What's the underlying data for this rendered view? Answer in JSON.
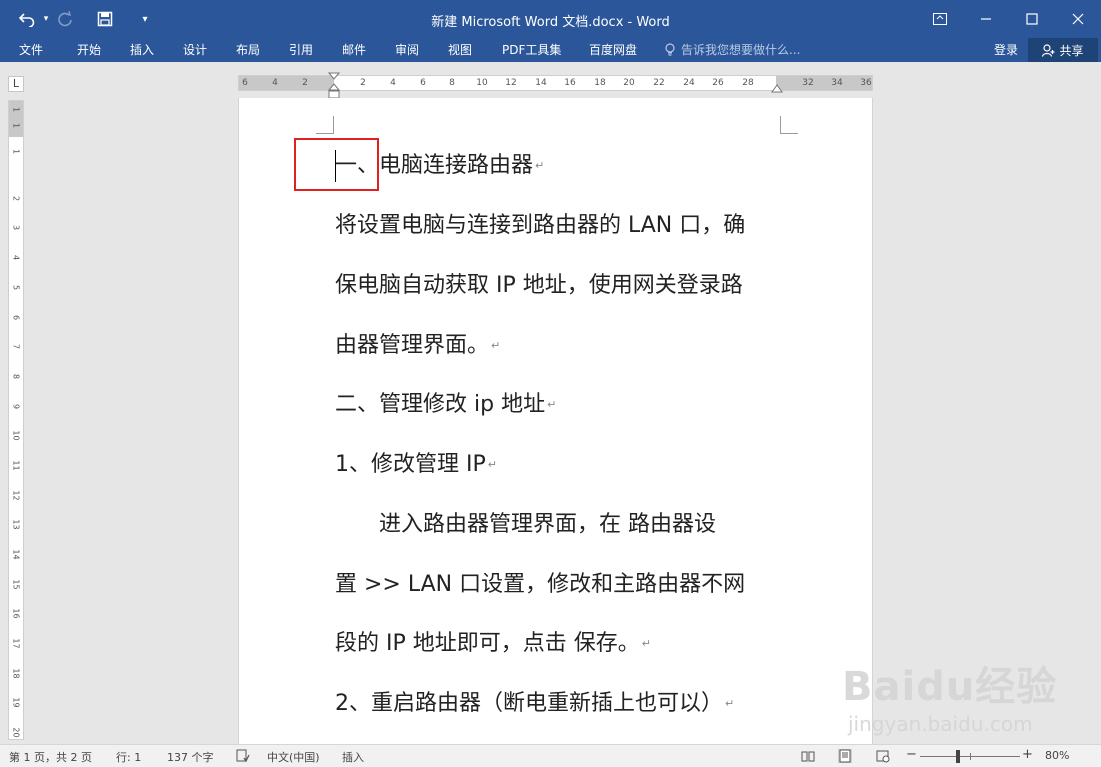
{
  "window": {
    "title": "新建 Microsoft Word 文档.docx - Word"
  },
  "quick_access": {
    "undo_icon": "undo-icon",
    "redo_icon": "redo-icon",
    "save_icon": "save-icon",
    "customize_icon": "customize-qat-icon"
  },
  "tabs": [
    "文件",
    "开始",
    "插入",
    "设计",
    "布局",
    "引用",
    "邮件",
    "审阅",
    "视图",
    "PDF工具集",
    "百度网盘"
  ],
  "tell_me": "告诉我您想要做什么...",
  "account": {
    "login": "登录",
    "share": "共享"
  },
  "ruler": {
    "corner": "L",
    "h_ticks": [
      "6",
      "4",
      "2",
      "2",
      "4",
      "6",
      "8",
      "10",
      "12",
      "14",
      "16",
      "18",
      "20",
      "22",
      "24",
      "26",
      "28",
      "32",
      "34",
      "36"
    ],
    "v_ticks": [
      "1",
      "1",
      "1",
      "2",
      "3",
      "4",
      "5",
      "6",
      "7",
      "8",
      "9",
      "10",
      "11",
      "12",
      "13",
      "14",
      "15",
      "16",
      "17",
      "18",
      "19",
      "20"
    ]
  },
  "document": {
    "lines": [
      {
        "text": "一、电脑连接路由器",
        "mark": "↵"
      },
      {
        "text": "将设置电脑与连接到路由器的 LAN 口，确",
        "mark": ""
      },
      {
        "text": "保电脑自动获取 IP 地址，使用网关登录路",
        "mark": ""
      },
      {
        "text": "由器管理界面。",
        "mark": "↵"
      },
      {
        "text": "二、管理修改 ip 地址",
        "mark": "↵"
      },
      {
        "text": "1、修改管理 IP",
        "mark": "↵"
      },
      {
        "text": "　　进入路由器管理界面，在  路由器设",
        "mark": ""
      },
      {
        "text": "置  >> LAN 口设置，修改和主路由器不网",
        "mark": ""
      },
      {
        "text": "段的 IP 地址即可，点击  保存。",
        "mark": "↵"
      },
      {
        "text": "2、重启路由器（断电重新插上也可以）",
        "mark": "↵"
      }
    ]
  },
  "watermark": {
    "logo": "Baidu经验",
    "url": "jingyan.baidu.com"
  },
  "status": {
    "page": "第 1 页，共 2 页",
    "line": "行: 1",
    "words": "137 个字",
    "language": "中文(中国)",
    "mode": "插入",
    "zoom": "80%"
  },
  "colors": {
    "ribbon": "#2b579a",
    "highlight_box": "#e0211f"
  }
}
